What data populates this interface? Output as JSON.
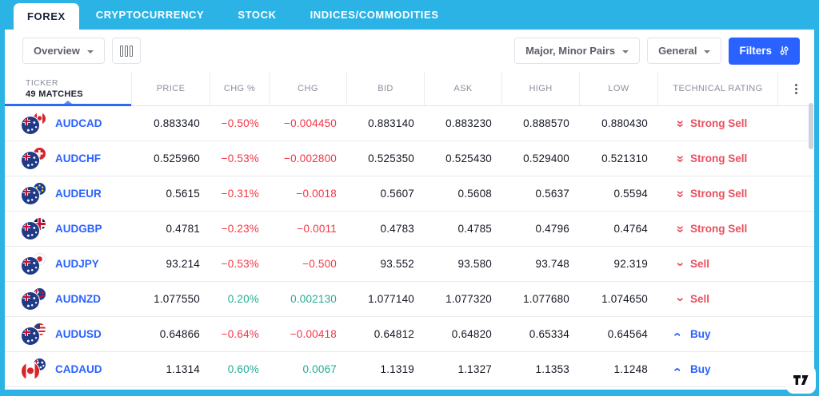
{
  "tabs": [
    {
      "label": "FOREX",
      "active": true
    },
    {
      "label": "CRYPTOCURRENCY",
      "active": false
    },
    {
      "label": "STOCK",
      "active": false
    },
    {
      "label": "INDICES/COMMODITIES",
      "active": false
    }
  ],
  "toolbar": {
    "view_label": "Overview",
    "pairs_filter_label": "Major, Minor Pairs",
    "category_filter_label": "General",
    "filters_button_label": "Filters"
  },
  "table": {
    "header": {
      "ticker_label": "TICKER",
      "matches_label": "49 MATCHES",
      "columns": [
        "PRICE",
        "CHG %",
        "CHG",
        "BID",
        "ASK",
        "HIGH",
        "LOW",
        "TECHNICAL RATING"
      ]
    },
    "rows": [
      {
        "ticker": "AUDCAD",
        "base": "aud",
        "quote": "cad",
        "price": "0.883340",
        "chg_pct": "−0.50%",
        "chg": "−0.004450",
        "bid": "0.883140",
        "ask": "0.883230",
        "high": "0.888570",
        "low": "0.880430",
        "rating": "Strong Sell",
        "rating_type": "strong-sell",
        "trend": "down"
      },
      {
        "ticker": "AUDCHF",
        "base": "aud",
        "quote": "chf",
        "price": "0.525960",
        "chg_pct": "−0.53%",
        "chg": "−0.002800",
        "bid": "0.525350",
        "ask": "0.525430",
        "high": "0.529400",
        "low": "0.521310",
        "rating": "Strong Sell",
        "rating_type": "strong-sell",
        "trend": "down"
      },
      {
        "ticker": "AUDEUR",
        "base": "aud",
        "quote": "eur",
        "price": "0.5615",
        "chg_pct": "−0.31%",
        "chg": "−0.0018",
        "bid": "0.5607",
        "ask": "0.5608",
        "high": "0.5637",
        "low": "0.5594",
        "rating": "Strong Sell",
        "rating_type": "strong-sell",
        "trend": "down"
      },
      {
        "ticker": "AUDGBP",
        "base": "aud",
        "quote": "gbp",
        "price": "0.4781",
        "chg_pct": "−0.23%",
        "chg": "−0.0011",
        "bid": "0.4783",
        "ask": "0.4785",
        "high": "0.4796",
        "low": "0.4764",
        "rating": "Strong Sell",
        "rating_type": "strong-sell",
        "trend": "down"
      },
      {
        "ticker": "AUDJPY",
        "base": "aud",
        "quote": "jpy",
        "price": "93.214",
        "chg_pct": "−0.53%",
        "chg": "−0.500",
        "bid": "93.552",
        "ask": "93.580",
        "high": "93.748",
        "low": "92.319",
        "rating": "Sell",
        "rating_type": "sell",
        "trend": "down"
      },
      {
        "ticker": "AUDNZD",
        "base": "aud",
        "quote": "nzd",
        "price": "1.077550",
        "chg_pct": "0.20%",
        "chg": "0.002130",
        "bid": "1.077140",
        "ask": "1.077320",
        "high": "1.077680",
        "low": "1.074650",
        "rating": "Sell",
        "rating_type": "sell",
        "trend": "up"
      },
      {
        "ticker": "AUDUSD",
        "base": "aud",
        "quote": "usd",
        "price": "0.64866",
        "chg_pct": "−0.64%",
        "chg": "−0.00418",
        "bid": "0.64812",
        "ask": "0.64820",
        "high": "0.65334",
        "low": "0.64564",
        "rating": "Buy",
        "rating_type": "buy",
        "trend": "down"
      },
      {
        "ticker": "CADAUD",
        "base": "cad",
        "quote": "aud",
        "price": "1.1314",
        "chg_pct": "0.60%",
        "chg": "0.0067",
        "bid": "1.1319",
        "ask": "1.1327",
        "high": "1.1353",
        "low": "1.1248",
        "rating": "Buy",
        "rating_type": "buy",
        "trend": "up"
      }
    ]
  },
  "icons": {
    "columns-icon": "three vertical bars",
    "caret-down-icon": "▾",
    "filters-icon": "sliders",
    "more-icon": "⋮",
    "chevron-single-icon": "‹",
    "chevron-double-down-icon": "«",
    "tradingview-logo": "TV"
  },
  "colors": {
    "tab_bar_cyan": "#2bb3e6",
    "primary_blue": "#2962ff",
    "negative_red": "#f23645",
    "positive_green": "#22ab94",
    "header_text": "#8b8f9d",
    "cell_text": "#131722",
    "border": "#e0e3eb"
  }
}
